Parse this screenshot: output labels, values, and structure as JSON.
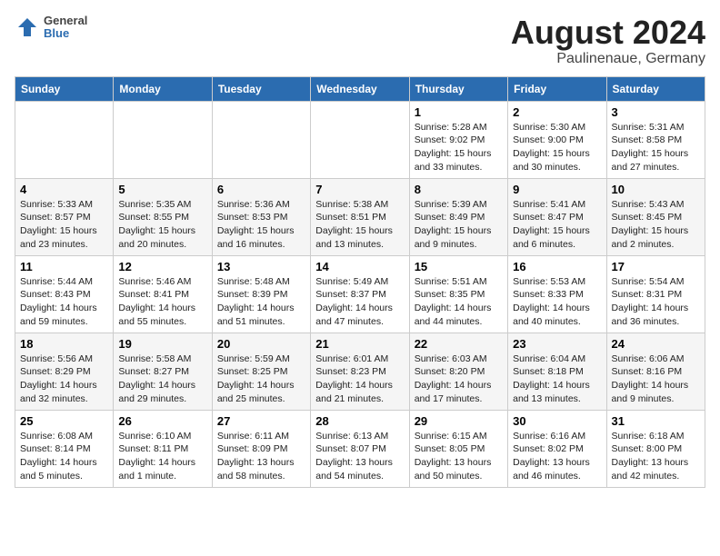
{
  "header": {
    "logo_line1": "General",
    "logo_line2": "Blue",
    "title": "August 2024",
    "subtitle": "Paulinenaue, Germany"
  },
  "weekdays": [
    "Sunday",
    "Monday",
    "Tuesday",
    "Wednesday",
    "Thursday",
    "Friday",
    "Saturday"
  ],
  "weeks": [
    [
      {
        "day": "",
        "info": ""
      },
      {
        "day": "",
        "info": ""
      },
      {
        "day": "",
        "info": ""
      },
      {
        "day": "",
        "info": ""
      },
      {
        "day": "1",
        "info": "Sunrise: 5:28 AM\nSunset: 9:02 PM\nDaylight: 15 hours\nand 33 minutes."
      },
      {
        "day": "2",
        "info": "Sunrise: 5:30 AM\nSunset: 9:00 PM\nDaylight: 15 hours\nand 30 minutes."
      },
      {
        "day": "3",
        "info": "Sunrise: 5:31 AM\nSunset: 8:58 PM\nDaylight: 15 hours\nand 27 minutes."
      }
    ],
    [
      {
        "day": "4",
        "info": "Sunrise: 5:33 AM\nSunset: 8:57 PM\nDaylight: 15 hours\nand 23 minutes."
      },
      {
        "day": "5",
        "info": "Sunrise: 5:35 AM\nSunset: 8:55 PM\nDaylight: 15 hours\nand 20 minutes."
      },
      {
        "day": "6",
        "info": "Sunrise: 5:36 AM\nSunset: 8:53 PM\nDaylight: 15 hours\nand 16 minutes."
      },
      {
        "day": "7",
        "info": "Sunrise: 5:38 AM\nSunset: 8:51 PM\nDaylight: 15 hours\nand 13 minutes."
      },
      {
        "day": "8",
        "info": "Sunrise: 5:39 AM\nSunset: 8:49 PM\nDaylight: 15 hours\nand 9 minutes."
      },
      {
        "day": "9",
        "info": "Sunrise: 5:41 AM\nSunset: 8:47 PM\nDaylight: 15 hours\nand 6 minutes."
      },
      {
        "day": "10",
        "info": "Sunrise: 5:43 AM\nSunset: 8:45 PM\nDaylight: 15 hours\nand 2 minutes."
      }
    ],
    [
      {
        "day": "11",
        "info": "Sunrise: 5:44 AM\nSunset: 8:43 PM\nDaylight: 14 hours\nand 59 minutes."
      },
      {
        "day": "12",
        "info": "Sunrise: 5:46 AM\nSunset: 8:41 PM\nDaylight: 14 hours\nand 55 minutes."
      },
      {
        "day": "13",
        "info": "Sunrise: 5:48 AM\nSunset: 8:39 PM\nDaylight: 14 hours\nand 51 minutes."
      },
      {
        "day": "14",
        "info": "Sunrise: 5:49 AM\nSunset: 8:37 PM\nDaylight: 14 hours\nand 47 minutes."
      },
      {
        "day": "15",
        "info": "Sunrise: 5:51 AM\nSunset: 8:35 PM\nDaylight: 14 hours\nand 44 minutes."
      },
      {
        "day": "16",
        "info": "Sunrise: 5:53 AM\nSunset: 8:33 PM\nDaylight: 14 hours\nand 40 minutes."
      },
      {
        "day": "17",
        "info": "Sunrise: 5:54 AM\nSunset: 8:31 PM\nDaylight: 14 hours\nand 36 minutes."
      }
    ],
    [
      {
        "day": "18",
        "info": "Sunrise: 5:56 AM\nSunset: 8:29 PM\nDaylight: 14 hours\nand 32 minutes."
      },
      {
        "day": "19",
        "info": "Sunrise: 5:58 AM\nSunset: 8:27 PM\nDaylight: 14 hours\nand 29 minutes."
      },
      {
        "day": "20",
        "info": "Sunrise: 5:59 AM\nSunset: 8:25 PM\nDaylight: 14 hours\nand 25 minutes."
      },
      {
        "day": "21",
        "info": "Sunrise: 6:01 AM\nSunset: 8:23 PM\nDaylight: 14 hours\nand 21 minutes."
      },
      {
        "day": "22",
        "info": "Sunrise: 6:03 AM\nSunset: 8:20 PM\nDaylight: 14 hours\nand 17 minutes."
      },
      {
        "day": "23",
        "info": "Sunrise: 6:04 AM\nSunset: 8:18 PM\nDaylight: 14 hours\nand 13 minutes."
      },
      {
        "day": "24",
        "info": "Sunrise: 6:06 AM\nSunset: 8:16 PM\nDaylight: 14 hours\nand 9 minutes."
      }
    ],
    [
      {
        "day": "25",
        "info": "Sunrise: 6:08 AM\nSunset: 8:14 PM\nDaylight: 14 hours\nand 5 minutes."
      },
      {
        "day": "26",
        "info": "Sunrise: 6:10 AM\nSunset: 8:11 PM\nDaylight: 14 hours\nand 1 minute."
      },
      {
        "day": "27",
        "info": "Sunrise: 6:11 AM\nSunset: 8:09 PM\nDaylight: 13 hours\nand 58 minutes."
      },
      {
        "day": "28",
        "info": "Sunrise: 6:13 AM\nSunset: 8:07 PM\nDaylight: 13 hours\nand 54 minutes."
      },
      {
        "day": "29",
        "info": "Sunrise: 6:15 AM\nSunset: 8:05 PM\nDaylight: 13 hours\nand 50 minutes."
      },
      {
        "day": "30",
        "info": "Sunrise: 6:16 AM\nSunset: 8:02 PM\nDaylight: 13 hours\nand 46 minutes."
      },
      {
        "day": "31",
        "info": "Sunrise: 6:18 AM\nSunset: 8:00 PM\nDaylight: 13 hours\nand 42 minutes."
      }
    ]
  ]
}
